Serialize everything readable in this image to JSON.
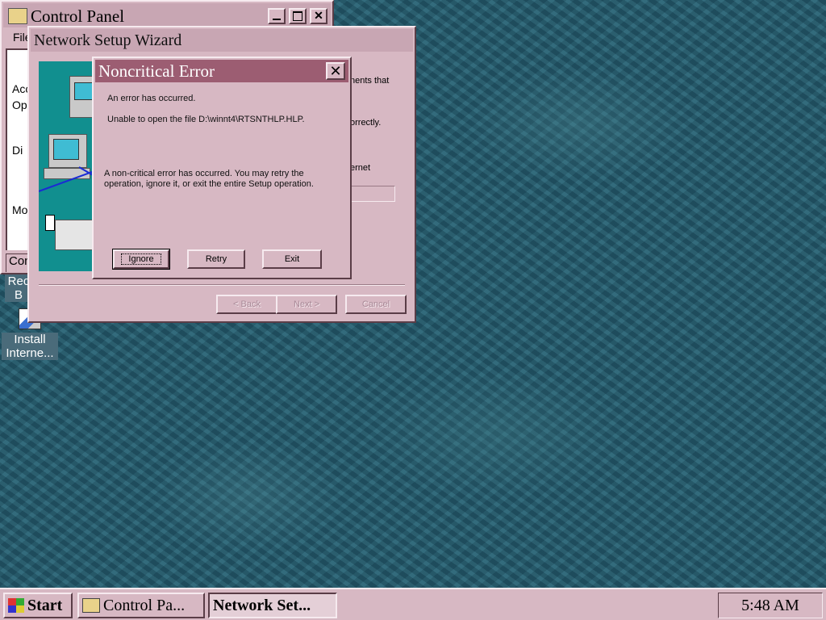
{
  "control_panel": {
    "title": "Control Panel",
    "menu_first": "File",
    "list_items": [
      "Acc",
      "Op",
      "Di",
      "Mo"
    ],
    "status": "Con"
  },
  "wizard": {
    "title": "Network Setup Wizard",
    "text_fragments": [
      "nents that",
      "orrectly.",
      "ernet"
    ],
    "buttons": {
      "back": "< Back",
      "next": "Next >",
      "cancel": "Cancel"
    }
  },
  "error_dialog": {
    "title": "Noncritical Error",
    "close_glyph": "✕",
    "line1": "An error has occurred.",
    "line2": "Unable to open the file D:\\winnt4\\RTSNTHLP.HLP.",
    "line3": "A non-critical error has occurred.  You may retry the",
    "line4": "operation, ignore it, or exit the entire Setup operation.",
    "buttons": {
      "ignore": "Ignore",
      "retry": "Retry",
      "exit": "Exit"
    }
  },
  "desktop": {
    "icon_partial_top": [
      "Rec",
      "B"
    ],
    "install_icon": [
      "Install",
      "Interne..."
    ]
  },
  "taskbar": {
    "start": "Start",
    "tasks": [
      "Control Pa...",
      "Network Set..."
    ],
    "clock": "5:48 AM"
  }
}
